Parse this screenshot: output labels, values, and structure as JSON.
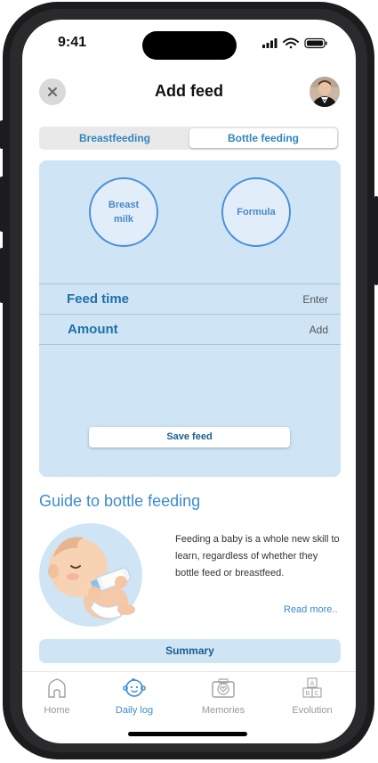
{
  "status_bar": {
    "time": "9:41"
  },
  "header": {
    "title": "Add feed"
  },
  "segmented": {
    "tabs": [
      "Breastfeeding",
      "Bottle feeding"
    ],
    "active": 1
  },
  "feed_types": {
    "breast_milk": "Breast milk",
    "formula": "Formula"
  },
  "form": {
    "feed_time": {
      "label": "Feed time",
      "value": "Enter"
    },
    "amount": {
      "label": "Amount",
      "value": "Add"
    }
  },
  "save_button": "Save feed",
  "guide": {
    "title": "Guide to bottle feeding",
    "text": "Feeding a baby is a whole new skill to learn, regardless of whether they bottle feed or breastfeed.",
    "read_more": "Read more.."
  },
  "summary_button": "Summary",
  "tabbar": {
    "items": [
      {
        "label": "Home",
        "icon": "home-icon"
      },
      {
        "label": "Daily log",
        "icon": "baby-face-icon"
      },
      {
        "label": "Memories",
        "icon": "camera-heart-icon"
      },
      {
        "label": "Evolution",
        "icon": "abc-blocks-icon"
      }
    ],
    "active": 1
  },
  "colors": {
    "accent": "#3b8bd0",
    "panel": "#cfe5f5"
  }
}
